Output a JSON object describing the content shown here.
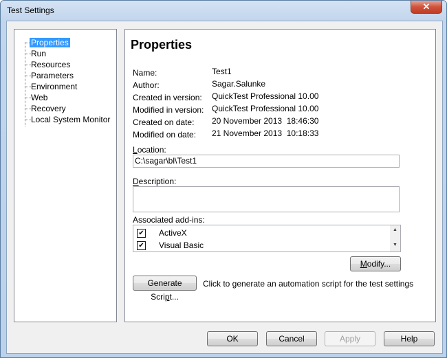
{
  "window": {
    "title": "Test Settings",
    "close_glyph": "✕"
  },
  "tree": {
    "items": [
      {
        "label": "Properties",
        "selected": true
      },
      {
        "label": "Run"
      },
      {
        "label": "Resources"
      },
      {
        "label": "Parameters"
      },
      {
        "label": "Environment"
      },
      {
        "label": "Web"
      },
      {
        "label": "Recovery"
      },
      {
        "label": "Local System Monitor"
      }
    ]
  },
  "panel": {
    "title": "Properties",
    "properties": [
      {
        "label": "Name:",
        "value": "Test1"
      },
      {
        "label": "Author:",
        "value": "Sagar.Salunke"
      },
      {
        "label": "Created in version:",
        "value": "QuickTest Professional 10.00"
      },
      {
        "label": "Modified in version:",
        "value": "QuickTest Professional 10.00"
      },
      {
        "label": "Created on date:",
        "value": "20 November 2013  18:46:30"
      },
      {
        "label": "Modified on date:",
        "value": "21 November 2013  10:18:33"
      }
    ],
    "location": {
      "label_first": "L",
      "label_rest": "ocation:",
      "value": "C:\\sagar\\bl\\Test1"
    },
    "description": {
      "label_first": "D",
      "label_rest": "escription:",
      "value": ""
    },
    "addins": {
      "label": "Associated add-ins:",
      "items": [
        {
          "label": "ActiveX",
          "checked": true,
          "mark": "✔"
        },
        {
          "label": "Visual Basic",
          "checked": true,
          "mark": "✔"
        }
      ]
    },
    "modify_button": {
      "label_first": "M",
      "label_rest": "odify..."
    },
    "generate_button": {
      "label_pre": "Generate Scri",
      "label_u": "p",
      "label_rest": "t..."
    },
    "generate_hint": "Click to generate an automation script for the test settings"
  },
  "buttons": {
    "ok": "OK",
    "cancel": "Cancel",
    "apply": "Apply",
    "help": "Help"
  },
  "colors": {
    "selection": "#3399ff",
    "titlebar": "#c1d5ec",
    "close": "#c13d23"
  }
}
